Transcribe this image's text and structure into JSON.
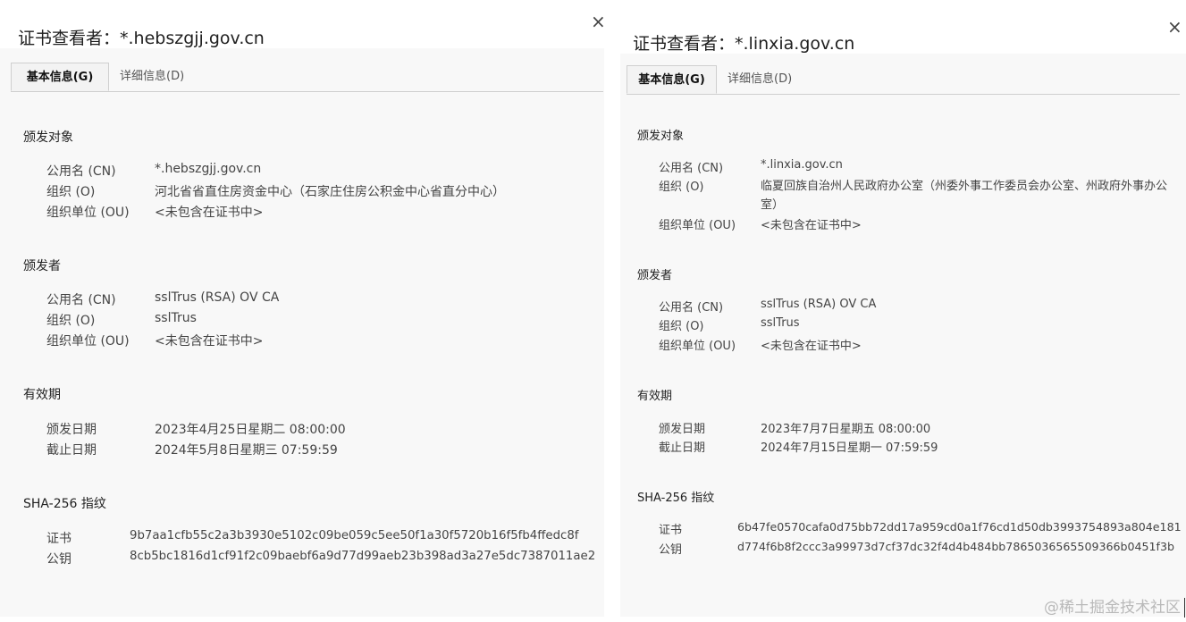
{
  "left": {
    "title": "证书查看者：*.hebszgjj.gov.cn",
    "close": "×",
    "tabs": [
      {
        "label": "基本信息(G)"
      },
      {
        "label": "详细信息(D)"
      }
    ],
    "subject": {
      "heading": "颁发对象",
      "rows": [
        {
          "key": "公用名 (CN)",
          "value": "*.hebszgjj.gov.cn"
        },
        {
          "key": "组织 (O)",
          "value": "河北省省直住房资金中心（石家庄住房公积金中心省直分中心）"
        },
        {
          "key": "组织单位 (OU)",
          "value": "<未包含在证书中>"
        }
      ]
    },
    "issuer": {
      "heading": "颁发者",
      "rows": [
        {
          "key": "公用名 (CN)",
          "value": "sslTrus (RSA) OV CA"
        },
        {
          "key": "组织 (O)",
          "value": "sslTrus"
        },
        {
          "key": "组织单位 (OU)",
          "value": "<未包含在证书中>"
        }
      ]
    },
    "validity": {
      "heading": "有效期",
      "rows": [
        {
          "key": "颁发日期",
          "value": "2023年4月25日星期二 08:00:00"
        },
        {
          "key": "截止日期",
          "value": "2024年5月8日星期三 07:59:59"
        }
      ]
    },
    "fingerprint": {
      "heading": "SHA-256 指纹",
      "rows": [
        {
          "key": "证书",
          "value": "9b7aa1cfb55c2a3b3930e5102c09be059c5ee50f1a30f5720b16f5fb4ffedc8f"
        },
        {
          "key": "公钥",
          "value": "8cb5bc1816d1cf91f2c09baebf6a9d77d99aeb23b398ad3a27e5dc7387011ae2"
        }
      ]
    }
  },
  "right": {
    "title": "证书查看者：*.linxia.gov.cn",
    "close": "×",
    "tabs": [
      {
        "label": "基本信息(G)"
      },
      {
        "label": "详细信息(D)"
      }
    ],
    "subject": {
      "heading": "颁发对象",
      "rows": [
        {
          "key": "公用名 (CN)",
          "value": "*.linxia.gov.cn"
        },
        {
          "key": "组织 (O)",
          "value": "临夏回族自治州人民政府办公室（州委外事工作委员会办公室、州政府外事办公室）"
        },
        {
          "key": "组织单位 (OU)",
          "value": "<未包含在证书中>"
        }
      ]
    },
    "issuer": {
      "heading": "颁发者",
      "rows": [
        {
          "key": "公用名 (CN)",
          "value": "sslTrus (RSA) OV CA"
        },
        {
          "key": "组织 (O)",
          "value": "sslTrus"
        },
        {
          "key": "组织单位 (OU)",
          "value": "<未包含在证书中>"
        }
      ]
    },
    "validity": {
      "heading": "有效期",
      "rows": [
        {
          "key": "颁发日期",
          "value": "2023年7月7日星期五 08:00:00"
        },
        {
          "key": "截止日期",
          "value": "2024年7月15日星期一 07:59:59"
        }
      ]
    },
    "fingerprint": {
      "heading": "SHA-256 指纹",
      "rows": [
        {
          "key": "证书",
          "value": "6b47fe0570cafa0d75bb72dd17a959cd0a1f76cd1d50db3993754893a804e181"
        },
        {
          "key": "公钥",
          "value": "d774f6b8f2ccc3a99973d7cf37dc32f4d4b484bb7865036565509366b0451f3b"
        }
      ]
    }
  },
  "watermark": "@稀土掘金技术社区"
}
